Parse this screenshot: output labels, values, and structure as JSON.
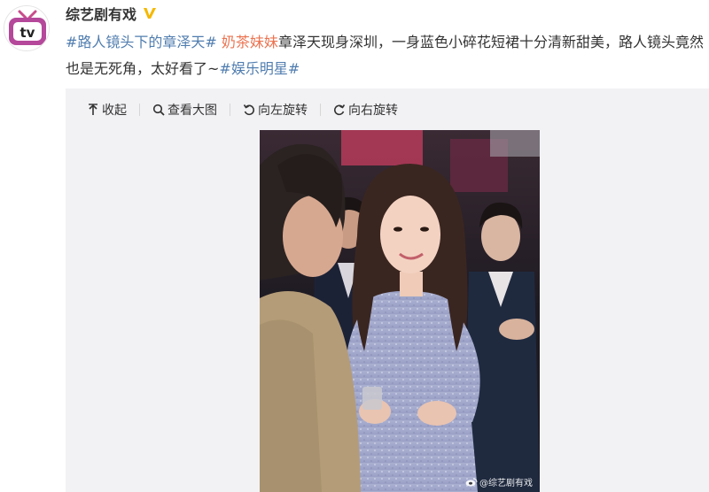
{
  "post": {
    "author": "综艺剧有戏",
    "verified": true,
    "avatar_icon": "tv-icon",
    "avatar_label": "tv",
    "text_parts": [
      {
        "type": "topic",
        "text": "#路人镜头下的章泽天#"
      },
      {
        "type": "text",
        "text": " "
      },
      {
        "type": "mention",
        "text": "奶茶妹妹"
      },
      {
        "type": "text",
        "text": "章泽天现身深圳，一身蓝色小碎花短裙十分清新甜美，路人镜头竟然也是无死角，太好看了~"
      },
      {
        "type": "topic",
        "text": "#娱乐明星#"
      }
    ]
  },
  "toolbar": {
    "collapse": "收起",
    "view_large": "查看大图",
    "rotate_left": "向左旋转",
    "rotate_right": "向右旋转"
  },
  "image": {
    "watermark": "@综艺剧有戏"
  },
  "colors": {
    "topic": "#507daf",
    "mention": "#eb7350",
    "toolbar_bg": "#f2f2f5",
    "badge": "#f5b800"
  }
}
